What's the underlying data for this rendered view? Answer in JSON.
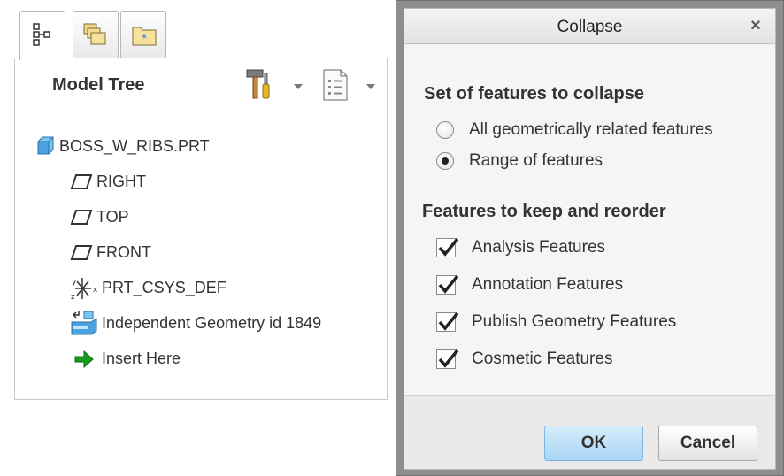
{
  "model_tree": {
    "tabs": [
      {
        "icon": "model-tree-icon"
      },
      {
        "icon": "folder-browser-icon"
      },
      {
        "icon": "favorites-icon"
      }
    ],
    "title": "Model Tree",
    "toolbar": {
      "settings_icon": "hammer-screwdriver-icon",
      "show_icon": "list-document-icon"
    },
    "items": [
      {
        "label": "BOSS_W_RIBS.PRT",
        "icon": "part-icon"
      },
      {
        "label": "RIGHT",
        "icon": "datum-plane-icon"
      },
      {
        "label": "TOP",
        "icon": "datum-plane-icon"
      },
      {
        "label": "FRONT",
        "icon": "datum-plane-icon"
      },
      {
        "label": "PRT_CSYS_DEF",
        "icon": "coordinate-system-icon"
      },
      {
        "label": "Independent Geometry id 1849",
        "icon": "independent-geometry-icon"
      },
      {
        "label": "Insert Here",
        "icon": "insert-arrow-icon"
      }
    ],
    "colors": {
      "arrow": "#1a9a1a",
      "part": "#4aa3e0"
    }
  },
  "dialog": {
    "title": "Collapse",
    "close_label": "×",
    "set_section": {
      "title": "Set of features to collapse",
      "options": [
        {
          "label": "All geometrically related features",
          "selected": false
        },
        {
          "label": "Range of features",
          "selected": true
        }
      ]
    },
    "keep_section": {
      "title": "Features to keep and reorder",
      "options": [
        {
          "label": "Analysis Features",
          "checked": true
        },
        {
          "label": "Annotation Features",
          "checked": true
        },
        {
          "label": "Publish Geometry Features",
          "checked": true
        },
        {
          "label": "Cosmetic Features",
          "checked": true
        }
      ]
    },
    "ok_label": "OK",
    "cancel_label": "Cancel",
    "colors": {
      "ok_button": "#bfe0f8"
    }
  }
}
